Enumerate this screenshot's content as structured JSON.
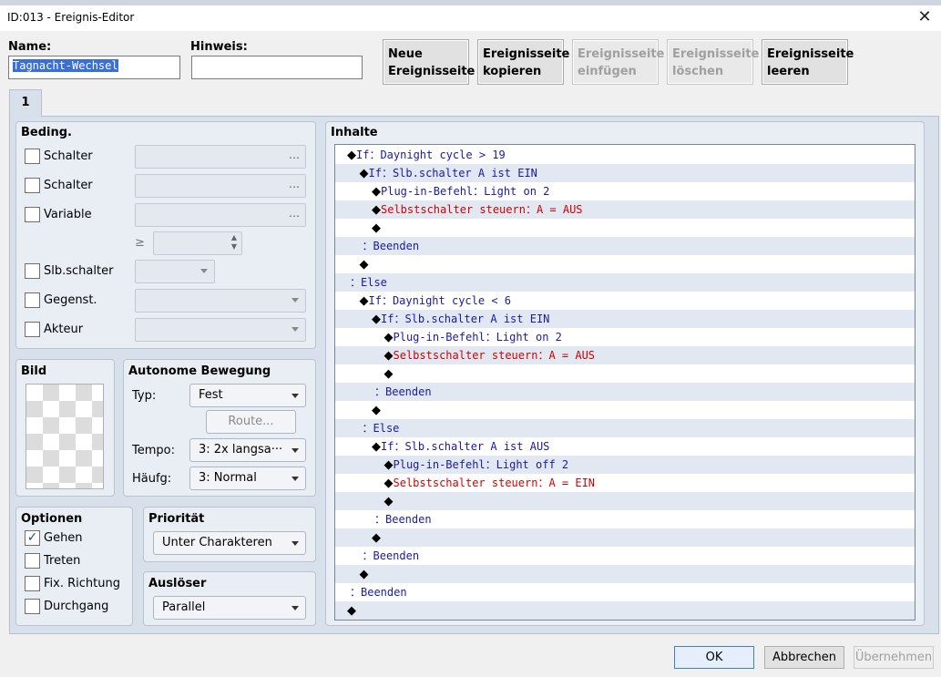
{
  "window": {
    "title": "ID:013 - Ereignis-Editor"
  },
  "header": {
    "name_label": "Name:",
    "name_value": "Tagnacht-Wechsel",
    "hint_label": "Hinweis:",
    "hint_value": "",
    "buttons": [
      {
        "line1": "Neue",
        "line2": "Ereignisseite",
        "enabled": true
      },
      {
        "line1": "Ereignisseite",
        "line2": "kopieren",
        "enabled": true
      },
      {
        "line1": "Ereignisseite",
        "line2": "einfügen",
        "enabled": false
      },
      {
        "line1": "Ereignisseite",
        "line2": "löschen",
        "enabled": false
      },
      {
        "line1": "Ereignisseite",
        "line2": "leeren",
        "enabled": true
      }
    ]
  },
  "tabs": [
    {
      "label": "1"
    }
  ],
  "conditions": {
    "title": "Beding.",
    "items": [
      {
        "label": "Schalter",
        "checked": false,
        "value": "…"
      },
      {
        "label": "Schalter",
        "checked": false,
        "value": "…"
      },
      {
        "label": "Variable",
        "checked": false,
        "value": "…"
      },
      {
        "label": "Slb.schalter",
        "checked": false
      },
      {
        "label": "Gegenst.",
        "checked": false
      },
      {
        "label": "Akteur",
        "checked": false
      }
    ],
    "geq": "≥"
  },
  "image": {
    "title": "Bild"
  },
  "movement": {
    "title": "Autonome Bewegung",
    "type_label": "Typ:",
    "type_value": "Fest",
    "route_button": "Route...",
    "speed_label": "Tempo:",
    "speed_value": "3: 2x langsa···",
    "freq_label": "Häufg:",
    "freq_value": "3: Normal"
  },
  "options": {
    "title": "Optionen",
    "items": [
      {
        "label": "Gehen",
        "checked": true,
        "mark": "✓"
      },
      {
        "label": "Treten",
        "checked": false
      },
      {
        "label": "Fix. Richtung",
        "checked": false
      },
      {
        "label": "Durchgang",
        "checked": false
      }
    ]
  },
  "priority": {
    "title": "Priorität",
    "value": "Unter Charakteren"
  },
  "trigger": {
    "title": "Auslöser",
    "value": "Parallel"
  },
  "contents": {
    "title": "Inhalte",
    "lines": [
      {
        "indent": 0,
        "text": "If：Daynight cycle > 19",
        "style": "cmd"
      },
      {
        "indent": 1,
        "text": "If：Slb.schalter A ist EIN",
        "style": "cmd"
      },
      {
        "indent": 2,
        "text": "Plug-in-Befehl：Light on 2",
        "style": "cmd"
      },
      {
        "indent": 2,
        "text": "Selbstschalter steuern：A = AUS",
        "style": "red"
      },
      {
        "indent": 2,
        "text": "",
        "style": "empty"
      },
      {
        "indent": 1,
        "text": "：Beenden",
        "style": "label"
      },
      {
        "indent": 1,
        "text": "",
        "style": "empty"
      },
      {
        "indent": 0,
        "text": "：Else",
        "style": "label"
      },
      {
        "indent": 1,
        "text": "If：Daynight cycle < 6",
        "style": "cmd"
      },
      {
        "indent": 2,
        "text": "If：Slb.schalter A ist EIN",
        "style": "cmd"
      },
      {
        "indent": 3,
        "text": "Plug-in-Befehl：Light on 2",
        "style": "cmd"
      },
      {
        "indent": 3,
        "text": "Selbstschalter steuern：A = AUS",
        "style": "red"
      },
      {
        "indent": 3,
        "text": "",
        "style": "empty"
      },
      {
        "indent": 2,
        "text": "：Beenden",
        "style": "label"
      },
      {
        "indent": 2,
        "text": "",
        "style": "empty"
      },
      {
        "indent": 1,
        "text": "：Else",
        "style": "label"
      },
      {
        "indent": 2,
        "text": "If：Slb.schalter A ist AUS",
        "style": "cmd"
      },
      {
        "indent": 3,
        "text": "Plug-in-Befehl：Light off 2",
        "style": "cmd"
      },
      {
        "indent": 3,
        "text": "Selbstschalter steuern：A = EIN",
        "style": "red"
      },
      {
        "indent": 3,
        "text": "",
        "style": "empty"
      },
      {
        "indent": 2,
        "text": "：Beenden",
        "style": "label"
      },
      {
        "indent": 2,
        "text": "",
        "style": "empty"
      },
      {
        "indent": 1,
        "text": "：Beenden",
        "style": "label"
      },
      {
        "indent": 1,
        "text": "",
        "style": "empty"
      },
      {
        "indent": 0,
        "text": "：Beenden",
        "style": "label"
      },
      {
        "indent": 0,
        "text": "",
        "style": "empty"
      }
    ]
  },
  "footer": {
    "ok": "OK",
    "cancel": "Abbrechen",
    "apply": "Übernehmen"
  },
  "icons": {
    "close": "close-icon",
    "diamond": "diamond-icon",
    "dropdown": "chevron-down-icon"
  }
}
